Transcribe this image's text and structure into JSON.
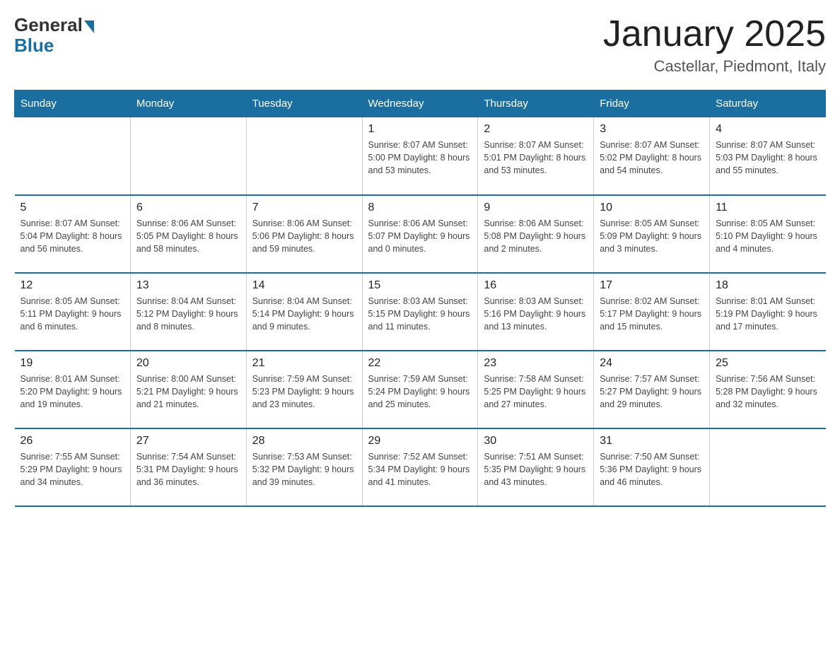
{
  "header": {
    "logo_general": "General",
    "logo_blue": "Blue",
    "month_title": "January 2025",
    "location": "Castellar, Piedmont, Italy"
  },
  "days_of_week": [
    "Sunday",
    "Monday",
    "Tuesday",
    "Wednesday",
    "Thursday",
    "Friday",
    "Saturday"
  ],
  "weeks": [
    [
      {
        "day": "",
        "info": ""
      },
      {
        "day": "",
        "info": ""
      },
      {
        "day": "",
        "info": ""
      },
      {
        "day": "1",
        "info": "Sunrise: 8:07 AM\nSunset: 5:00 PM\nDaylight: 8 hours\nand 53 minutes."
      },
      {
        "day": "2",
        "info": "Sunrise: 8:07 AM\nSunset: 5:01 PM\nDaylight: 8 hours\nand 53 minutes."
      },
      {
        "day": "3",
        "info": "Sunrise: 8:07 AM\nSunset: 5:02 PM\nDaylight: 8 hours\nand 54 minutes."
      },
      {
        "day": "4",
        "info": "Sunrise: 8:07 AM\nSunset: 5:03 PM\nDaylight: 8 hours\nand 55 minutes."
      }
    ],
    [
      {
        "day": "5",
        "info": "Sunrise: 8:07 AM\nSunset: 5:04 PM\nDaylight: 8 hours\nand 56 minutes."
      },
      {
        "day": "6",
        "info": "Sunrise: 8:06 AM\nSunset: 5:05 PM\nDaylight: 8 hours\nand 58 minutes."
      },
      {
        "day": "7",
        "info": "Sunrise: 8:06 AM\nSunset: 5:06 PM\nDaylight: 8 hours\nand 59 minutes."
      },
      {
        "day": "8",
        "info": "Sunrise: 8:06 AM\nSunset: 5:07 PM\nDaylight: 9 hours\nand 0 minutes."
      },
      {
        "day": "9",
        "info": "Sunrise: 8:06 AM\nSunset: 5:08 PM\nDaylight: 9 hours\nand 2 minutes."
      },
      {
        "day": "10",
        "info": "Sunrise: 8:05 AM\nSunset: 5:09 PM\nDaylight: 9 hours\nand 3 minutes."
      },
      {
        "day": "11",
        "info": "Sunrise: 8:05 AM\nSunset: 5:10 PM\nDaylight: 9 hours\nand 4 minutes."
      }
    ],
    [
      {
        "day": "12",
        "info": "Sunrise: 8:05 AM\nSunset: 5:11 PM\nDaylight: 9 hours\nand 6 minutes."
      },
      {
        "day": "13",
        "info": "Sunrise: 8:04 AM\nSunset: 5:12 PM\nDaylight: 9 hours\nand 8 minutes."
      },
      {
        "day": "14",
        "info": "Sunrise: 8:04 AM\nSunset: 5:14 PM\nDaylight: 9 hours\nand 9 minutes."
      },
      {
        "day": "15",
        "info": "Sunrise: 8:03 AM\nSunset: 5:15 PM\nDaylight: 9 hours\nand 11 minutes."
      },
      {
        "day": "16",
        "info": "Sunrise: 8:03 AM\nSunset: 5:16 PM\nDaylight: 9 hours\nand 13 minutes."
      },
      {
        "day": "17",
        "info": "Sunrise: 8:02 AM\nSunset: 5:17 PM\nDaylight: 9 hours\nand 15 minutes."
      },
      {
        "day": "18",
        "info": "Sunrise: 8:01 AM\nSunset: 5:19 PM\nDaylight: 9 hours\nand 17 minutes."
      }
    ],
    [
      {
        "day": "19",
        "info": "Sunrise: 8:01 AM\nSunset: 5:20 PM\nDaylight: 9 hours\nand 19 minutes."
      },
      {
        "day": "20",
        "info": "Sunrise: 8:00 AM\nSunset: 5:21 PM\nDaylight: 9 hours\nand 21 minutes."
      },
      {
        "day": "21",
        "info": "Sunrise: 7:59 AM\nSunset: 5:23 PM\nDaylight: 9 hours\nand 23 minutes."
      },
      {
        "day": "22",
        "info": "Sunrise: 7:59 AM\nSunset: 5:24 PM\nDaylight: 9 hours\nand 25 minutes."
      },
      {
        "day": "23",
        "info": "Sunrise: 7:58 AM\nSunset: 5:25 PM\nDaylight: 9 hours\nand 27 minutes."
      },
      {
        "day": "24",
        "info": "Sunrise: 7:57 AM\nSunset: 5:27 PM\nDaylight: 9 hours\nand 29 minutes."
      },
      {
        "day": "25",
        "info": "Sunrise: 7:56 AM\nSunset: 5:28 PM\nDaylight: 9 hours\nand 32 minutes."
      }
    ],
    [
      {
        "day": "26",
        "info": "Sunrise: 7:55 AM\nSunset: 5:29 PM\nDaylight: 9 hours\nand 34 minutes."
      },
      {
        "day": "27",
        "info": "Sunrise: 7:54 AM\nSunset: 5:31 PM\nDaylight: 9 hours\nand 36 minutes."
      },
      {
        "day": "28",
        "info": "Sunrise: 7:53 AM\nSunset: 5:32 PM\nDaylight: 9 hours\nand 39 minutes."
      },
      {
        "day": "29",
        "info": "Sunrise: 7:52 AM\nSunset: 5:34 PM\nDaylight: 9 hours\nand 41 minutes."
      },
      {
        "day": "30",
        "info": "Sunrise: 7:51 AM\nSunset: 5:35 PM\nDaylight: 9 hours\nand 43 minutes."
      },
      {
        "day": "31",
        "info": "Sunrise: 7:50 AM\nSunset: 5:36 PM\nDaylight: 9 hours\nand 46 minutes."
      },
      {
        "day": "",
        "info": ""
      }
    ]
  ]
}
